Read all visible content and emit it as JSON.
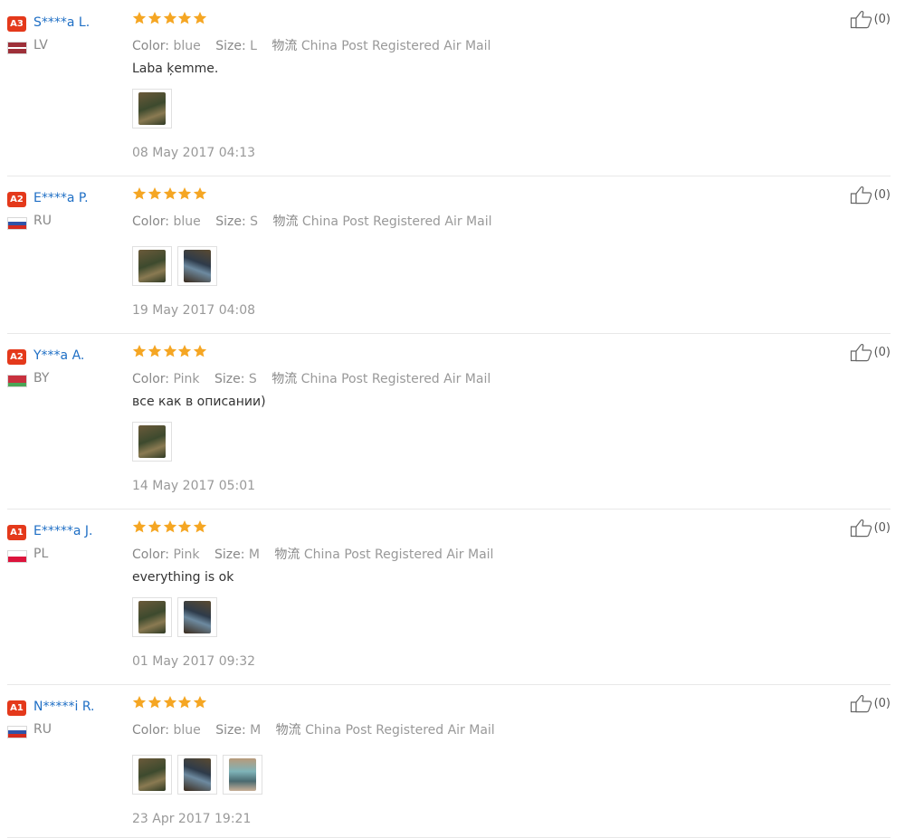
{
  "labels": {
    "color": "Color:",
    "size": "Size:",
    "shipping": "物流"
  },
  "accent": "#e4391b",
  "link_color": "#1f6fc5",
  "star_color": "#f5a623",
  "reviews": [
    {
      "level": "A3",
      "name": "S****a L.",
      "country": "LV",
      "flag": "latvia-flag",
      "rating": 5,
      "color": "blue",
      "size": "L",
      "shipping": "China Post Registered Air Mail",
      "text": "Laba ķemme.",
      "images": [
        "photo-1"
      ],
      "date": "08 May 2017 04:13",
      "likes": "(0)"
    },
    {
      "level": "A2",
      "name": "E****a P.",
      "country": "RU",
      "flag": "russia-flag",
      "rating": 5,
      "color": "blue",
      "size": "S",
      "shipping": "China Post Registered Air Mail",
      "text": "",
      "images": [
        "photo-1",
        "photo-2"
      ],
      "date": "19 May 2017 04:08",
      "likes": "(0)"
    },
    {
      "level": "A2",
      "name": "Y***a A.",
      "country": "BY",
      "flag": "belarus-flag",
      "rating": 5,
      "color": "Pink",
      "size": "S",
      "shipping": "China Post Registered Air Mail",
      "text": "все как в описании)",
      "images": [
        "photo-1"
      ],
      "date": "14 May 2017 05:01",
      "likes": "(0)"
    },
    {
      "level": "A1",
      "name": "E*****a J.",
      "country": "PL",
      "flag": "poland-flag",
      "rating": 5,
      "color": "Pink",
      "size": "M",
      "shipping": "China Post Registered Air Mail",
      "text": "everything is ok",
      "images": [
        "photo-1",
        "photo-2"
      ],
      "date": "01 May 2017 09:32",
      "likes": "(0)"
    },
    {
      "level": "A1",
      "name": "N*****i R.",
      "country": "RU",
      "flag": "russia-flag",
      "rating": 5,
      "color": "blue",
      "size": "M",
      "shipping": "China Post Registered Air Mail",
      "text": "",
      "images": [
        "photo-1",
        "photo-2",
        "photo-3"
      ],
      "date": "23 Apr 2017 19:21",
      "likes": "(0)"
    }
  ]
}
